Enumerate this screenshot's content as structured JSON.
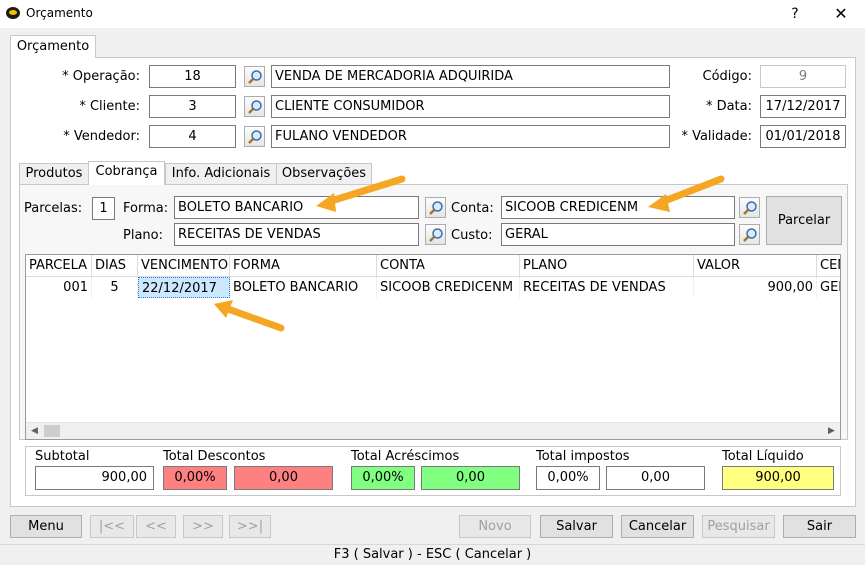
{
  "window": {
    "title": "Orçamento",
    "help": "?",
    "close": "✕",
    "icon": "app-logo-icon"
  },
  "outer_tab": "Orçamento",
  "header": {
    "operacao": {
      "label": "* Operação:",
      "code": "18",
      "desc": "VENDA DE MERCADORIA ADQUIRIDA"
    },
    "cliente": {
      "label": "* Cliente:",
      "code": "3",
      "desc": "CLIENTE CONSUMIDOR"
    },
    "vendedor": {
      "label": "* Vendedor:",
      "code": "4",
      "desc": "FULANO VENDEDOR"
    },
    "codigo": {
      "label": "Código:",
      "value": "9"
    },
    "data": {
      "label": "* Data:",
      "value": "17/12/2017"
    },
    "validade": {
      "label": "* Validade:",
      "value": "01/01/2018"
    }
  },
  "tabs": [
    "Produtos",
    "Cobrança",
    "Info. Adicionais",
    "Observações"
  ],
  "active_tab": "Cobrança",
  "cobranca": {
    "parcelas_label": "Parcelas:",
    "parcelas_value": "1",
    "forma_label": "Forma:",
    "forma_value": "BOLETO BANCARIO",
    "conta_label": "Conta:",
    "conta_value": "SICOOB CREDICENM",
    "plano_label": "Plano:",
    "plano_value": "RECEITAS DE VENDAS",
    "custo_label": "Custo:",
    "custo_value": "GERAL",
    "parcelar_button": "Parcelar"
  },
  "grid": {
    "columns": [
      "PARCELA",
      "DIAS",
      "VENCIMENTO",
      "FORMA",
      "CONTA",
      "PLANO",
      "VALOR",
      "CEN"
    ],
    "rows": [
      [
        "001",
        "5",
        "22/12/2017",
        "BOLETO BANCARIO",
        "SICOOB CREDICENM",
        "RECEITAS DE VENDAS",
        "900,00",
        "GER"
      ]
    ],
    "scroll_left": "◀",
    "scroll_right": "▶"
  },
  "totals": {
    "subtotal": {
      "label": "Subtotal",
      "value": "900,00"
    },
    "descontos": {
      "label": "Total Descontos",
      "pct": "0,00%",
      "value": "0,00"
    },
    "acrescimos": {
      "label": "Total Acréscimos",
      "pct": "0,00%",
      "value": "0,00"
    },
    "impostos": {
      "label": "Total impostos",
      "pct": "0,00%",
      "value": "0,00"
    },
    "liquido": {
      "label": "Total Líquido",
      "value": "900,00"
    }
  },
  "colors": {
    "descontos": "#ff8080",
    "acrescimos": "#80ff80",
    "liquido": "#ffff80",
    "arrow": "#f5a623"
  },
  "buttons": {
    "menu": "Menu",
    "first": "|<<",
    "prev": "<<",
    "next": ">>",
    "last": ">>|",
    "novo": "Novo",
    "salvar": "Salvar",
    "cancelar": "Cancelar",
    "pesquisar": "Pesquisar",
    "sair": "Sair"
  },
  "status": "F3 ( Salvar )  -  ESC ( Cancelar )"
}
